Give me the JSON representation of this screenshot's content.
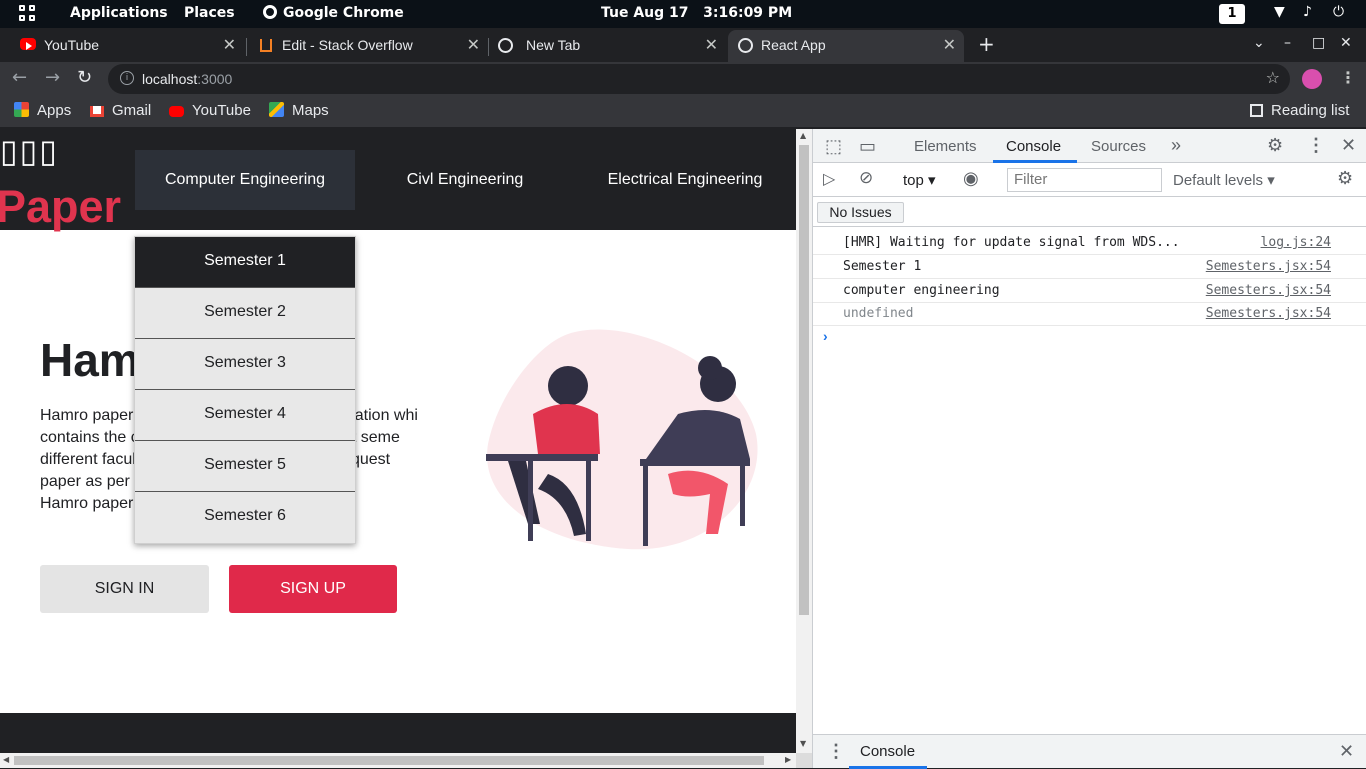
{
  "system_bar": {
    "applications": "Applications",
    "places": "Places",
    "active_app": "Google Chrome",
    "datetime": "Tue Aug 17   3:16:09 PM",
    "workspace": "1"
  },
  "tabs": [
    {
      "title": "YouTube",
      "icon": "youtube-icon"
    },
    {
      "title": "Edit - Stack Overflow",
      "icon": "stackoverflow-icon"
    },
    {
      "title": "New Tab",
      "icon": "chrome-icon"
    },
    {
      "title": "React App",
      "icon": "globe-icon",
      "active": true
    }
  ],
  "omnibox": {
    "host": "localhost",
    "port": ":3000"
  },
  "bookmarks": [
    {
      "label": "Apps"
    },
    {
      "label": "Gmail"
    },
    {
      "label": "YouTube"
    },
    {
      "label": "Maps"
    }
  ],
  "reading_list": "Reading list",
  "site": {
    "logo_glyphs": "▯▯▯",
    "logo_text": "Paper",
    "nav": [
      "Computer Engineering",
      "Civl Engineering",
      "Electrical Engineering"
    ],
    "dropdown": [
      "Semester 1",
      "Semester 2",
      "Semester 3",
      "Semester 4",
      "Semester 5",
      "Semester 6"
    ],
    "hero_title": "Ham",
    "hero_lines": [
      "Hamro paper                              y web application whi",
      "contains the c                           on of different seme",
      "different facul                           nd download quest",
      "paper as per",
      "Hamro paper"
    ],
    "sign_in": "SIGN IN",
    "sign_up": "SIGN UP"
  },
  "devtools": {
    "tabs": [
      "Elements",
      "Console",
      "Sources"
    ],
    "context": "top",
    "filter_placeholder": "Filter",
    "levels": "Default levels",
    "issues": "No Issues",
    "logs": [
      {
        "msg": "[HMR] Waiting for update signal from WDS...",
        "src": "log.js:24"
      },
      {
        "msg": "Semester 1",
        "src": "Semesters.jsx:54"
      },
      {
        "msg": "computer engineering",
        "src": "Semesters.jsx:54"
      },
      {
        "msg": "undefined",
        "src": "Semesters.jsx:54"
      }
    ],
    "drawer_tab": "Console"
  }
}
